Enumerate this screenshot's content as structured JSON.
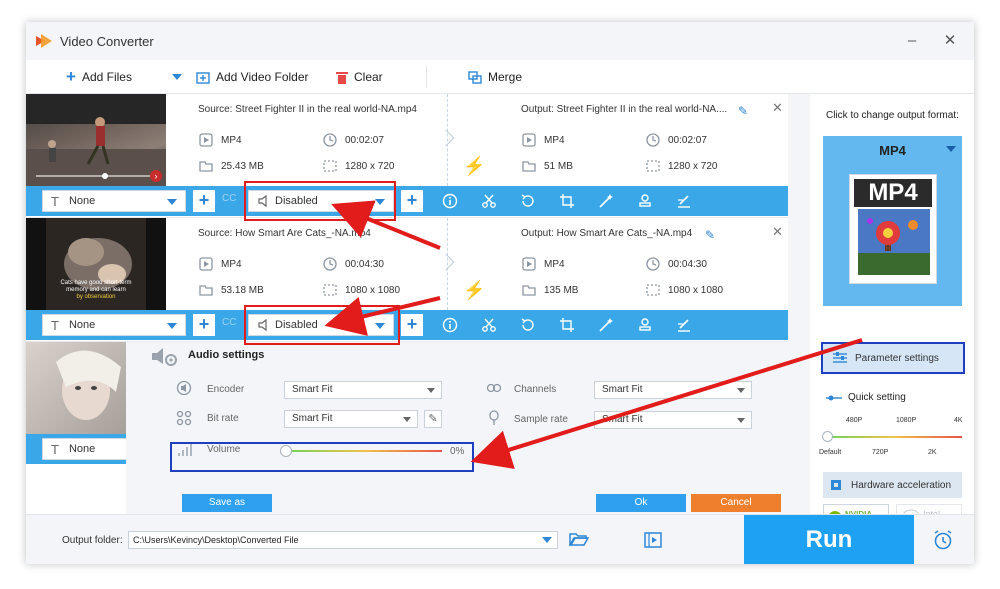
{
  "app": {
    "title": "Video Converter"
  },
  "toolbar": {
    "add_files": "Add Files",
    "add_video_folder": "Add Video Folder",
    "clear": "Clear",
    "merge": "Merge"
  },
  "files": [
    {
      "source": "Source: Street Fighter II in the real world-NA.mp4",
      "output": "Output: Street Fighter II in the real world-NA....",
      "src_format": "MP4",
      "src_duration": "00:02:07",
      "src_size": "25.43 MB",
      "src_resolution": "1280 x 720",
      "out_format": "MP4",
      "out_duration": "00:02:07",
      "out_size": "51 MB",
      "out_resolution": "1280 x 720",
      "subtitle": "None",
      "audio": "Disabled"
    },
    {
      "source": "Source: How Smart Are Cats_-NA.mp4",
      "output": "Output: How Smart Are Cats_-NA.mp4",
      "src_format": "MP4",
      "src_duration": "00:04:30",
      "src_size": "53.18 MB",
      "src_resolution": "1080 x 1080",
      "out_format": "MP4",
      "out_duration": "00:04:30",
      "out_size": "135 MB",
      "out_resolution": "1080 x 1080",
      "subtitle": "None",
      "audio": "Disabled",
      "thumb_caption": [
        "Cats have good short-term",
        "memory and can learn",
        "by observation"
      ]
    },
    {
      "subtitle": "None"
    }
  ],
  "strip": {
    "cc": "CC"
  },
  "audio_settings": {
    "title": "Audio settings",
    "encoder_label": "Encoder",
    "encoder_value": "Smart Fit",
    "bitrate_label": "Bit rate",
    "bitrate_value": "Smart Fit",
    "channels_label": "Channels",
    "channels_value": "Smart Fit",
    "samplerate_label": "Sample rate",
    "samplerate_value": "Smart Fit",
    "volume_label": "Volume",
    "volume_value": "0%",
    "volume_level": 0,
    "save_as": "Save as",
    "ok": "Ok",
    "cancel": "Cancel"
  },
  "right_panel": {
    "output_hint": "Click to change output format:",
    "format": "MP4",
    "format_badge": "MP4",
    "parameter_settings": "Parameter settings",
    "quick_setting": "Quick setting",
    "quality_top": [
      "480P",
      "1080P",
      "4K"
    ],
    "quality_bottom": [
      "Default",
      "720P",
      "2K"
    ],
    "hw_accel": "Hardware acceleration",
    "nvidia": "NVIDIA",
    "intel": "Intel"
  },
  "bottom": {
    "output_folder_label": "Output folder:",
    "output_folder_path": "C:\\Users\\Kevincy\\Desktop\\Converted File",
    "run": "Run"
  },
  "colors": {
    "accent": "#3aa7e8",
    "run": "#1ea0f3",
    "highlight_red": "#e21b1b",
    "highlight_blue": "#1f3fbf",
    "bolt": "#ff8a00"
  }
}
